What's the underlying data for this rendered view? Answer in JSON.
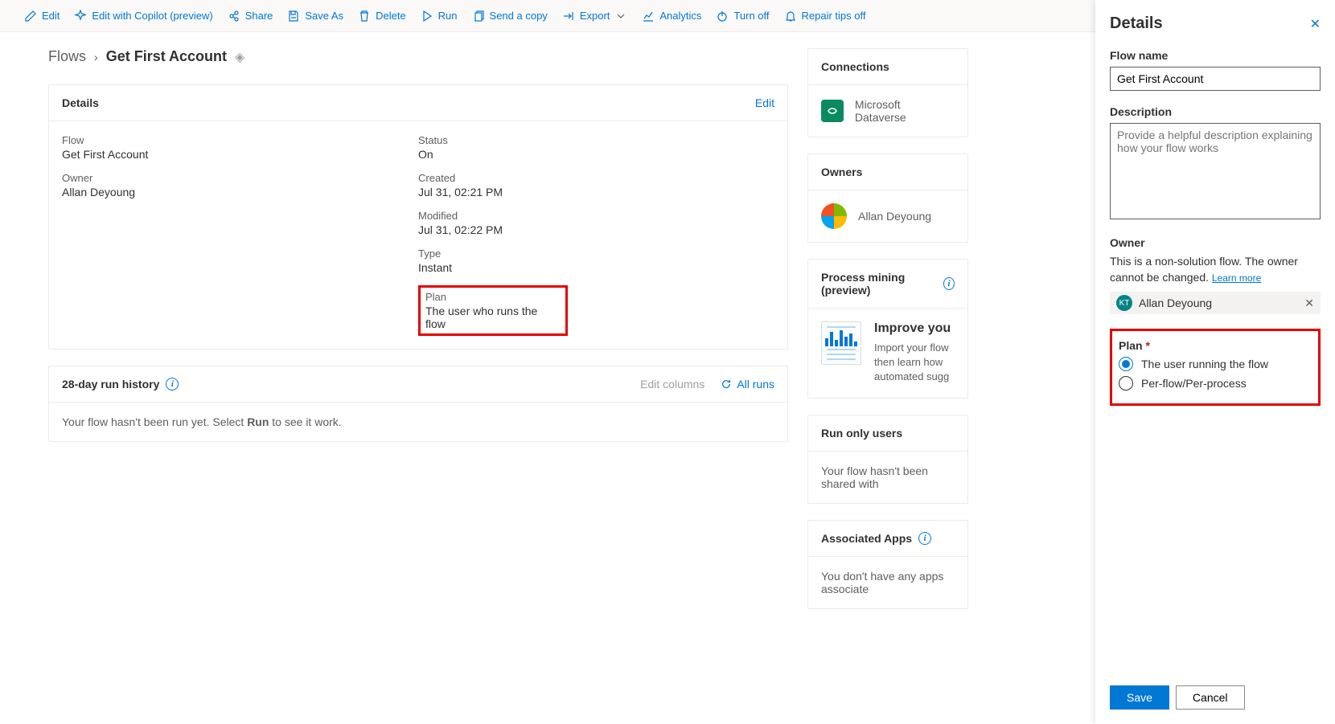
{
  "toolbar": {
    "edit": "Edit",
    "edit_copilot": "Edit with Copilot (preview)",
    "share": "Share",
    "save_as": "Save As",
    "delete": "Delete",
    "run": "Run",
    "send_copy": "Send a copy",
    "export": "Export",
    "analytics": "Analytics",
    "turn_off": "Turn off",
    "repair_tips": "Repair tips off"
  },
  "breadcrumb": {
    "root": "Flows",
    "current": "Get First Account"
  },
  "details_card": {
    "title": "Details",
    "edit": "Edit",
    "flow_label": "Flow",
    "flow_value": "Get First Account",
    "owner_label": "Owner",
    "owner_value": "Allan Deyoung",
    "status_label": "Status",
    "status_value": "On",
    "created_label": "Created",
    "created_value": "Jul 31, 02:21 PM",
    "modified_label": "Modified",
    "modified_value": "Jul 31, 02:22 PM",
    "type_label": "Type",
    "type_value": "Instant",
    "plan_label": "Plan",
    "plan_value": "The user who runs the flow"
  },
  "run_history": {
    "title": "28-day run history",
    "edit_columns": "Edit columns",
    "all_runs": "All runs",
    "empty_pre": "Your flow hasn't been run yet. Select ",
    "empty_bold": "Run",
    "empty_post": " to see it work."
  },
  "side": {
    "connections_title": "Connections",
    "connection_name": "Microsoft Dataverse",
    "owners_title": "Owners",
    "owner_name": "Allan Deyoung",
    "pm_title": "Process mining (preview)",
    "pm_heading": "Improve you",
    "pm_body": "Import your flow then learn how automated sugg",
    "rou_title": "Run only users",
    "rou_body": "Your flow hasn't been shared with",
    "apps_title": "Associated Apps",
    "apps_body": "You don't have any apps associate"
  },
  "panel": {
    "title": "Details",
    "flow_name_label": "Flow name",
    "flow_name_value": "Get First Account",
    "desc_label": "Description",
    "desc_placeholder": "Provide a helpful description explaining how your flow works",
    "owner_label": "Owner",
    "owner_note": "This is a non-solution flow. The owner cannot be changed. ",
    "learn_more": "Learn more",
    "owner_chip_initials": "KT",
    "owner_chip_name": "Allan Deyoung",
    "plan_label": "Plan",
    "plan_opt1": "The user running the flow",
    "plan_opt2": "Per-flow/Per-process",
    "save": "Save",
    "cancel": "Cancel"
  }
}
